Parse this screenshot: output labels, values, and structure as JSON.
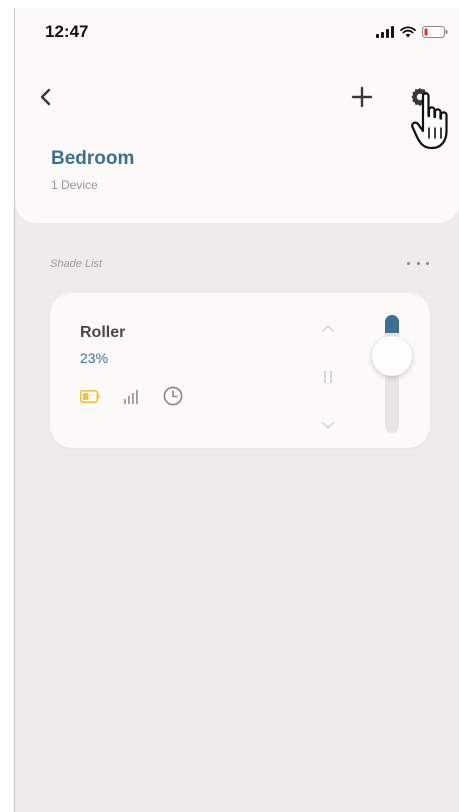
{
  "status_bar": {
    "time": "12:47"
  },
  "header": {
    "room_name": "Bedroom",
    "device_count": "1 Device"
  },
  "section": {
    "label": "Shade List"
  },
  "shade": {
    "name": "Roller",
    "position_label": "23%",
    "position_value": 0.23,
    "battery_level": "low"
  },
  "icons": {
    "back": "chevron-left-icon",
    "add": "plus-icon",
    "settings": "gear-icon",
    "cursor": "hand-pointer-icon",
    "more": "ellipsis-icon",
    "battery": "battery-icon",
    "signal": "signal-bars-icon",
    "schedule": "clock-icon",
    "up": "chevron-up-icon",
    "pause": "pause-icon",
    "down": "chevron-down-icon"
  },
  "colors": {
    "accent": "#3d6f93",
    "battery_low": "#f2c23a",
    "background": "#efebe8",
    "card": "#fbfaf9"
  }
}
